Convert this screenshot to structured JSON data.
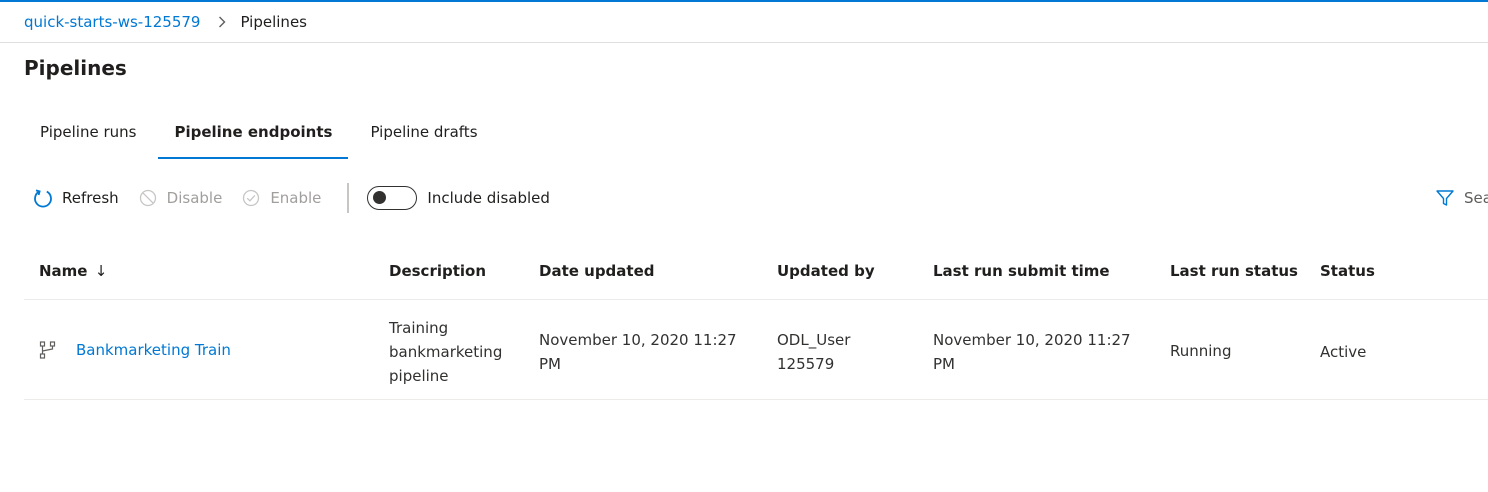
{
  "breadcrumb": {
    "workspace": "quick-starts-ws-125579",
    "current": "Pipelines"
  },
  "page": {
    "title": "Pipelines"
  },
  "tabs": [
    {
      "label": "Pipeline runs",
      "active": false
    },
    {
      "label": "Pipeline endpoints",
      "active": true
    },
    {
      "label": "Pipeline drafts",
      "active": false
    }
  ],
  "toolbar": {
    "refresh_label": "Refresh",
    "disable_label": "Disable",
    "enable_label": "Enable",
    "include_disabled_label": "Include disabled",
    "include_disabled_on": false,
    "search_label": "Sea"
  },
  "table": {
    "columns": {
      "name": "Name",
      "name_sort": "↓",
      "description": "Description",
      "date_updated": "Date updated",
      "updated_by": "Updated by",
      "last_run_submit_time": "Last run submit time",
      "last_run_status": "Last run status",
      "status": "Status"
    },
    "rows": [
      {
        "name": "Bankmarketing Train",
        "description_lines": [
          "Training",
          "bankmarketing",
          "pipeline"
        ],
        "date_updated_lines": [
          "November 10, 2020 11:27",
          "PM"
        ],
        "updated_by_lines": [
          "ODL_User",
          "125579"
        ],
        "last_run_submit_time_lines": [
          "November 10, 2020 11:27",
          "PM"
        ],
        "last_run_status": "Running",
        "status": "Active"
      }
    ]
  },
  "colors": {
    "accent": "#0078d4",
    "text": "#201f1e",
    "disabled": "#a19f9d"
  },
  "icons": {
    "refresh": "refresh-icon",
    "disable": "disable-circle-icon",
    "enable": "check-circle-icon",
    "filter": "filter-icon",
    "pipeline": "pipeline-icon",
    "breadcrumb_separator": "chevron-right-icon"
  }
}
